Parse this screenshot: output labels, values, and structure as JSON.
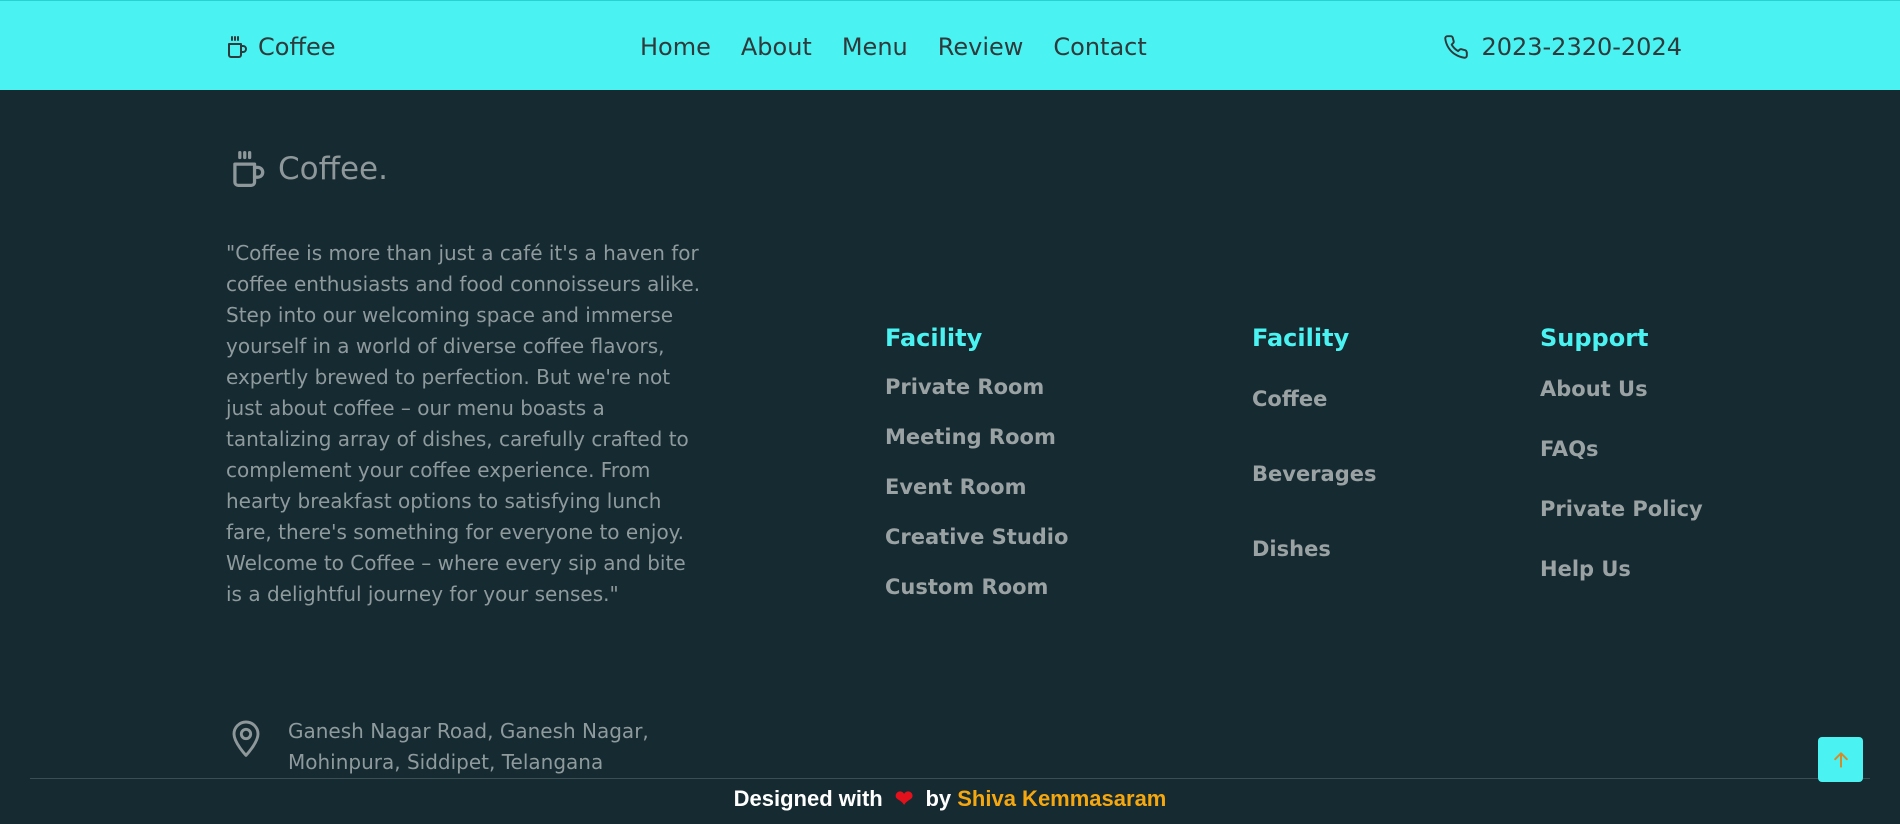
{
  "header": {
    "brand": "Coffee",
    "nav": [
      "Home",
      "About",
      "Menu",
      "Review",
      "Contact"
    ],
    "phone": "2023-2320-2024"
  },
  "footer": {
    "logo_text": "Coffee.",
    "about": "\"Coffee is more than just a café it's a haven for coffee enthusiasts and food connoisseurs alike. Step into our welcoming space and immerse yourself in a world of diverse coffee flavors, expertly brewed to perfection. But we're not just about coffee – our menu boasts a tantalizing array of dishes, carefully crafted to complement your coffee experience. From hearty breakfast options to satisfying lunch fare, there's something for everyone to enjoy. Welcome to Coffee – where every sip and bite is a delightful journey for your senses.\"",
    "address": "Ganesh Nagar Road, Ganesh Nagar, Mohinpura, Siddipet, Telangana",
    "columns": [
      {
        "title": "Facility",
        "links": [
          "Private Room",
          "Meeting Room",
          "Event Room",
          "Creative Studio",
          "Custom Room"
        ]
      },
      {
        "title": "Facility",
        "links": [
          "Coffee",
          "Beverages",
          "Dishes"
        ]
      },
      {
        "title": "Support",
        "links": [
          "About Us",
          "FAQs",
          "Private Policy",
          "Help Us"
        ]
      }
    ]
  },
  "credit": {
    "prefix": "Designed with",
    "heart": "❤",
    "by": "by",
    "author": "Shiva Kemmasaram"
  },
  "icons": {
    "brand": "coffee-cup-icon",
    "phone": "phone-icon",
    "location": "map-pin-icon",
    "scroll_top": "arrow-up-icon"
  },
  "colors": {
    "accent": "#4af3f1",
    "background": "#152a31",
    "heart": "#e3111b",
    "author": "#f5a70f"
  }
}
